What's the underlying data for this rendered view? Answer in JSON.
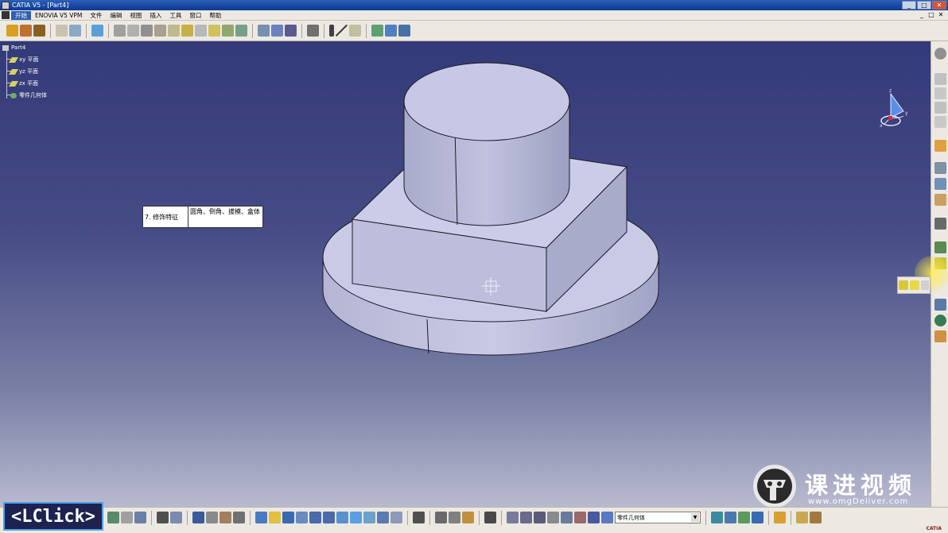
{
  "window": {
    "title": "CATIA V5 - [Part4]",
    "buttons": [
      "_",
      "□",
      "✕"
    ]
  },
  "menu": {
    "items": [
      "开始",
      "ENOVIA V5 VPM",
      "文件",
      "编辑",
      "视图",
      "插入",
      "工具",
      "窗口",
      "帮助"
    ],
    "mdi_buttons": [
      "_",
      "□",
      "✕"
    ]
  },
  "tree": {
    "root": "Part4",
    "planes": [
      "xy 平面",
      "yz 平面",
      "zx 平面"
    ],
    "body": "零件几何体"
  },
  "tooltip": {
    "index": "7. 修饰特征",
    "description": "圆角、倒角、拔模、盒体"
  },
  "compass": {
    "axes": [
      "z",
      "y",
      "x"
    ]
  },
  "bottom_toolbar": {
    "body_selector": "零件几何体"
  },
  "overlay": {
    "action": "<LClick>"
  },
  "watermark": {
    "name": "课进视频",
    "url": "www.omgDeliver.com"
  },
  "status": {
    "brand": "CATIA"
  },
  "colors": {
    "background_top": "#333a78",
    "background_bottom": "#b8bad0",
    "part_surface": "#c9cbe6",
    "toolbar": "#ece9e3",
    "badge_border": "#4aa3e8"
  }
}
